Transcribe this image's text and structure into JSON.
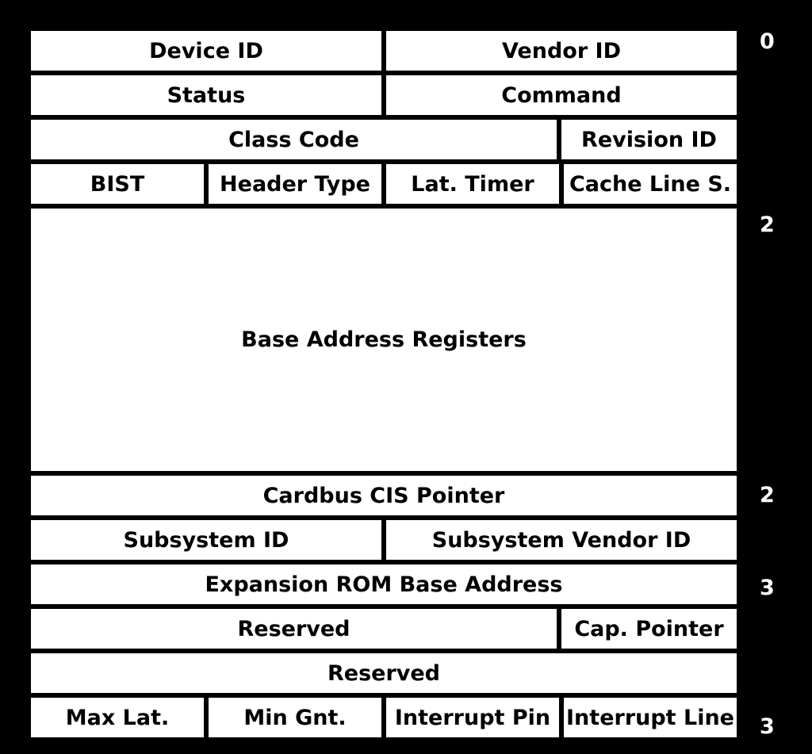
{
  "rows": [
    {
      "cells": [
        "Device ID",
        "Vendor ID"
      ],
      "widths": [
        "w2",
        "w2"
      ],
      "height": "h-norm"
    },
    {
      "cells": [
        "Status",
        "Command"
      ],
      "widths": [
        "w2",
        "w2"
      ],
      "height": "h-norm"
    },
    {
      "cells": [
        "Class Code",
        "Revision ID"
      ],
      "widths": [
        "w3",
        "w1"
      ],
      "height": "h-norm"
    },
    {
      "cells": [
        "BIST",
        "Header Type",
        "Lat. Timer",
        "Cache Line S."
      ],
      "widths": [
        "w1",
        "w1",
        "w1",
        "w1"
      ],
      "height": "h-norm"
    },
    {
      "cells": [
        "Base Address Registers"
      ],
      "widths": [
        "w4"
      ],
      "height": "h-tall"
    },
    {
      "cells": [
        "Cardbus CIS Pointer"
      ],
      "widths": [
        "w4"
      ],
      "height": "h-norm"
    },
    {
      "cells": [
        "Subsystem ID",
        "Subsystem Vendor ID"
      ],
      "widths": [
        "w2",
        "w2"
      ],
      "height": "h-norm"
    },
    {
      "cells": [
        "Expansion ROM Base Address"
      ],
      "widths": [
        "w4"
      ],
      "height": "h-norm"
    },
    {
      "cells": [
        "Reserved",
        "Cap. Pointer"
      ],
      "widths": [
        "w3",
        "w1"
      ],
      "height": "h-norm"
    },
    {
      "cells": [
        "Reserved"
      ],
      "widths": [
        "w4"
      ],
      "height": "h-norm"
    },
    {
      "cells": [
        "Max Lat.",
        "Min Gnt.",
        "Interrupt Pin",
        "Interrupt Line"
      ],
      "widths": [
        "w1",
        "w1",
        "w1",
        "w1"
      ],
      "height": "h-norm"
    }
  ],
  "offsets": {
    "top": "0",
    "bar_end": "2",
    "cis": "2",
    "rom": "3",
    "bottom": "3"
  }
}
